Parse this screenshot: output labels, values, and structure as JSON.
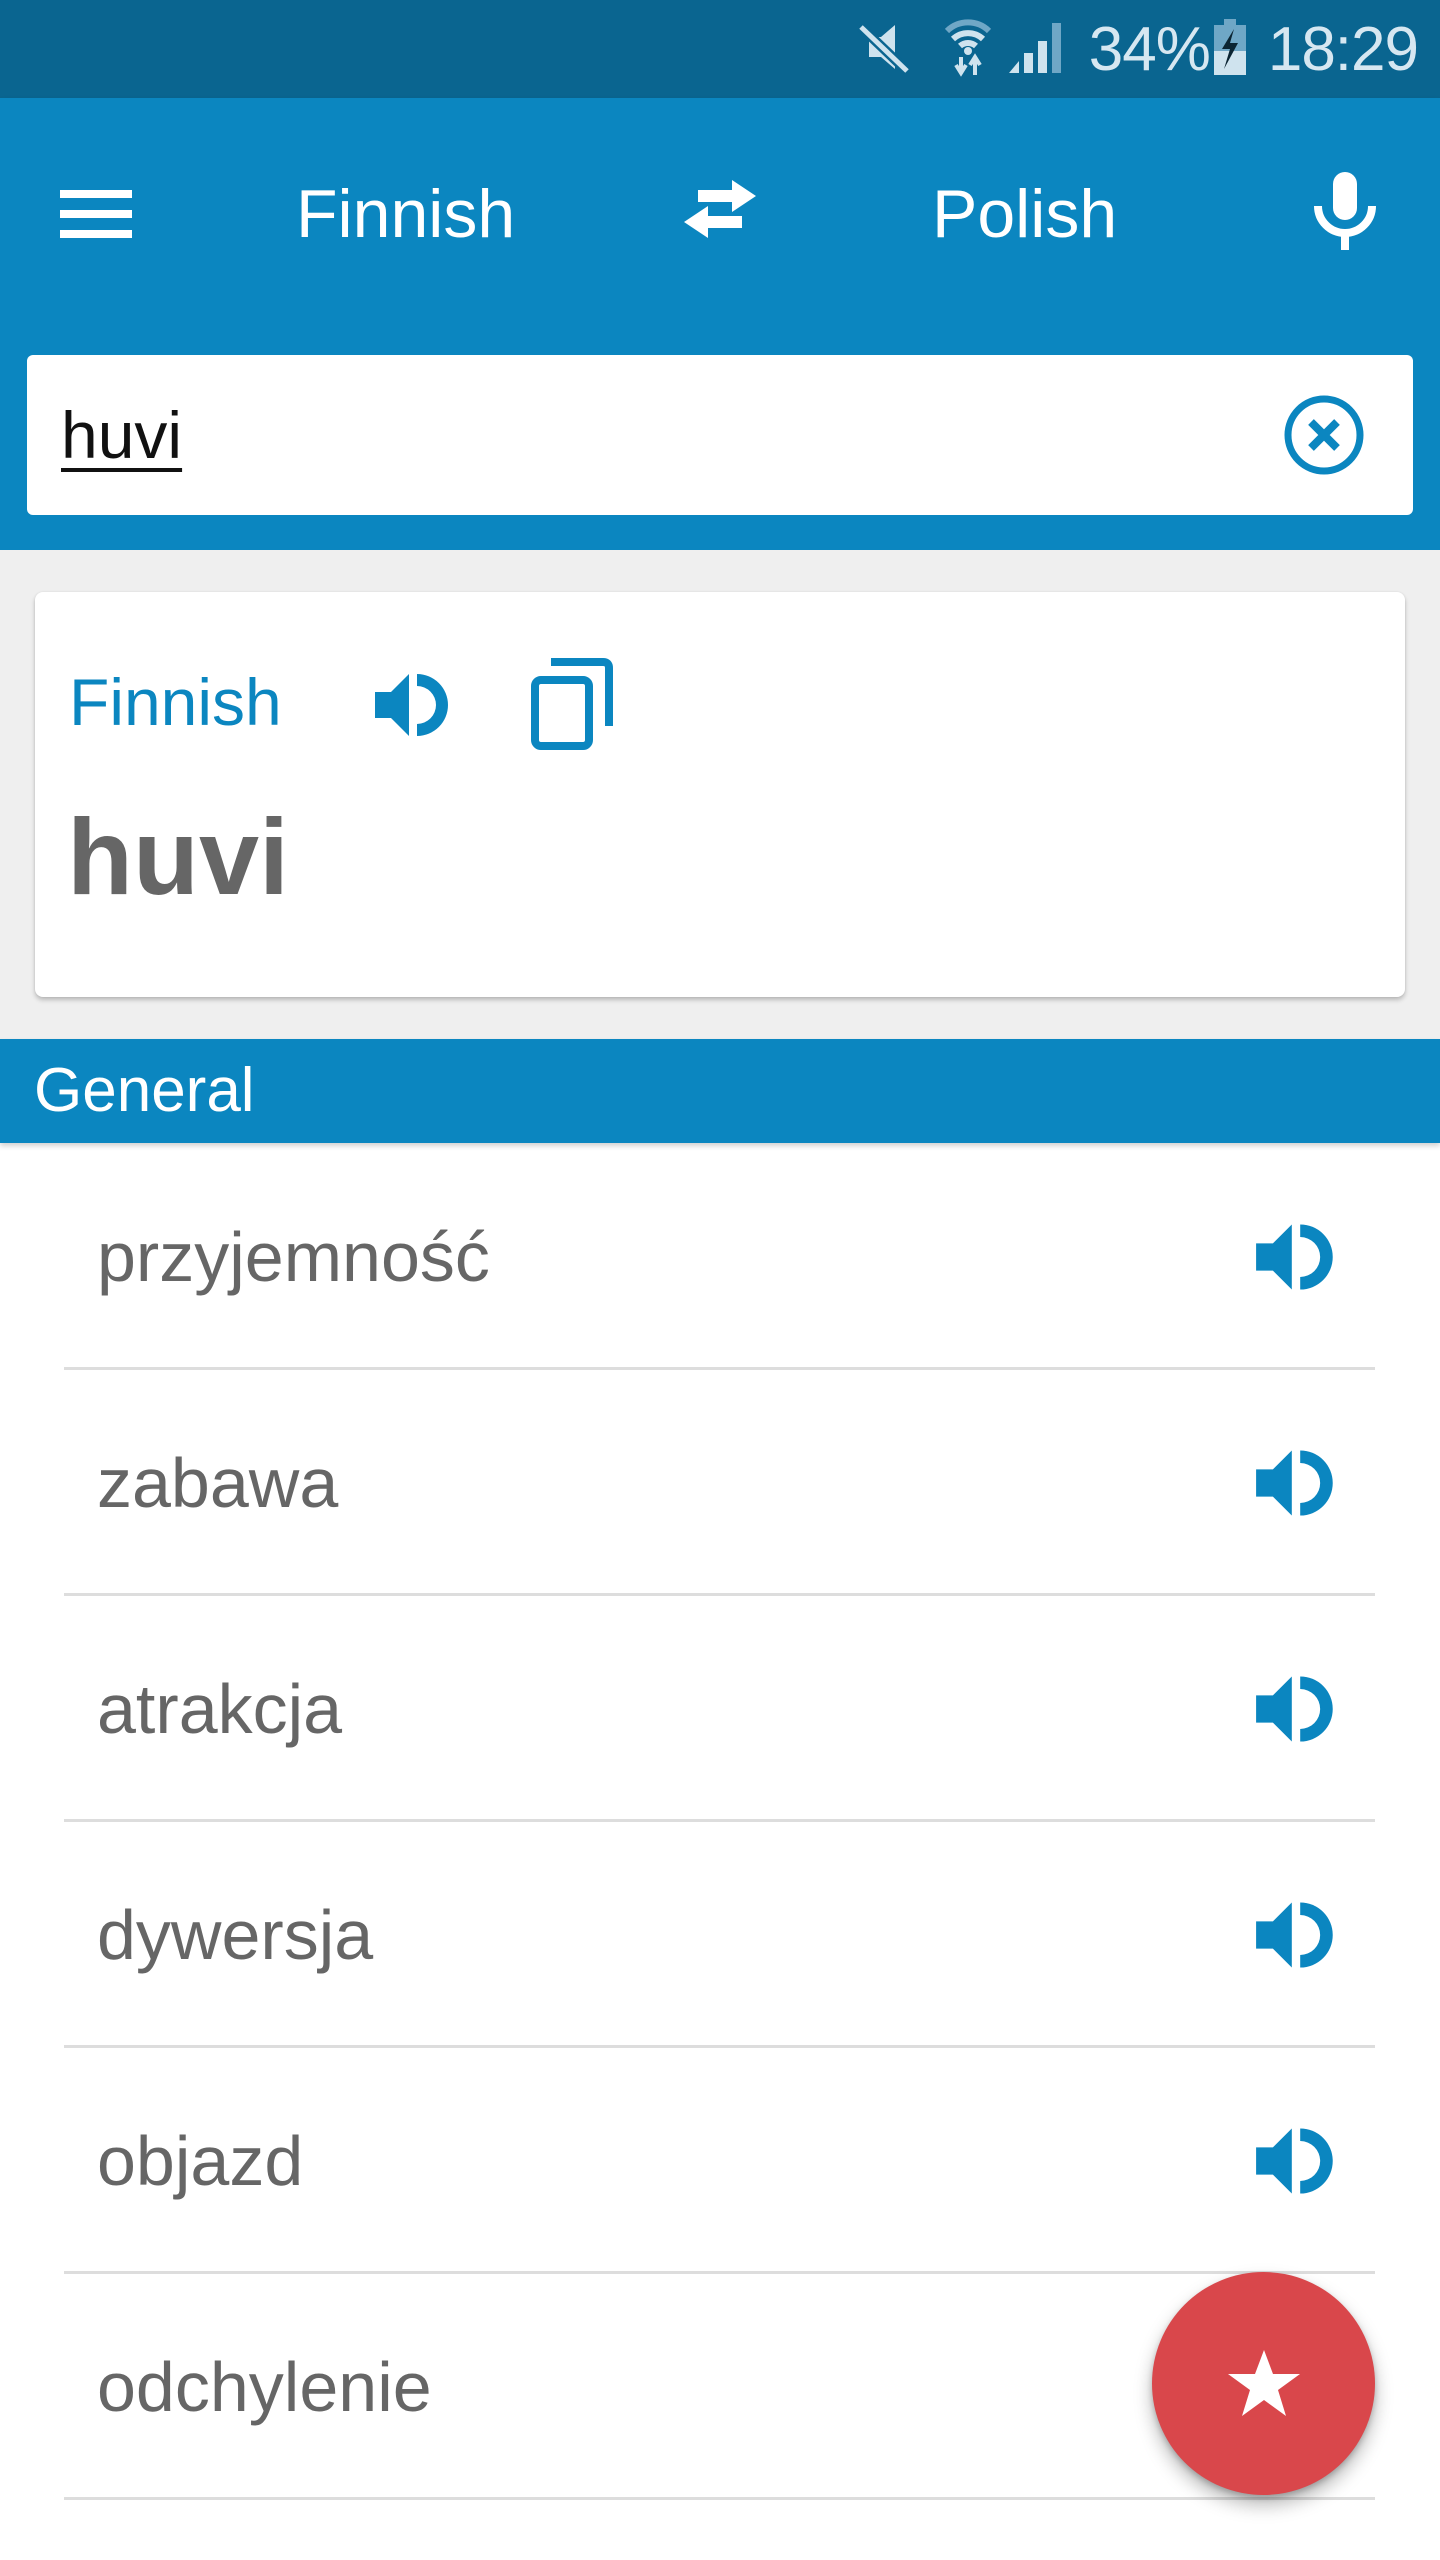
{
  "status_bar": {
    "battery_percent": "34%",
    "time": "18:29",
    "icons": [
      "mute-icon",
      "wifi-icon",
      "signal-icon",
      "battery-charging-icon"
    ]
  },
  "toolbar": {
    "menu_icon": "menu-icon",
    "source_language": "Finnish",
    "swap_icon": "swap-icon",
    "target_language": "Polish",
    "mic_icon": "microphone-icon"
  },
  "search": {
    "value": "huvi",
    "placeholder": "",
    "clear_icon": "clear-circle-icon"
  },
  "word_card": {
    "language": "Finnish",
    "word": "huvi",
    "speak_icon": "speaker-icon",
    "copy_icon": "copy-icon"
  },
  "colors": {
    "status_bar": "#0A6590",
    "primary": "#0B86C0",
    "background": "#EFEFEF",
    "text_gray": "#666666",
    "fab": "#D9474B"
  },
  "section": {
    "title": "General"
  },
  "translations": [
    {
      "text": "przyjemność",
      "has_audio": true
    },
    {
      "text": "zabawa",
      "has_audio": true
    },
    {
      "text": "atrakcja",
      "has_audio": true
    },
    {
      "text": "dywersja",
      "has_audio": true
    },
    {
      "text": "objazd",
      "has_audio": true
    },
    {
      "text": "odchylenie",
      "has_audio": false
    }
  ],
  "fab": {
    "icon": "star-icon"
  }
}
